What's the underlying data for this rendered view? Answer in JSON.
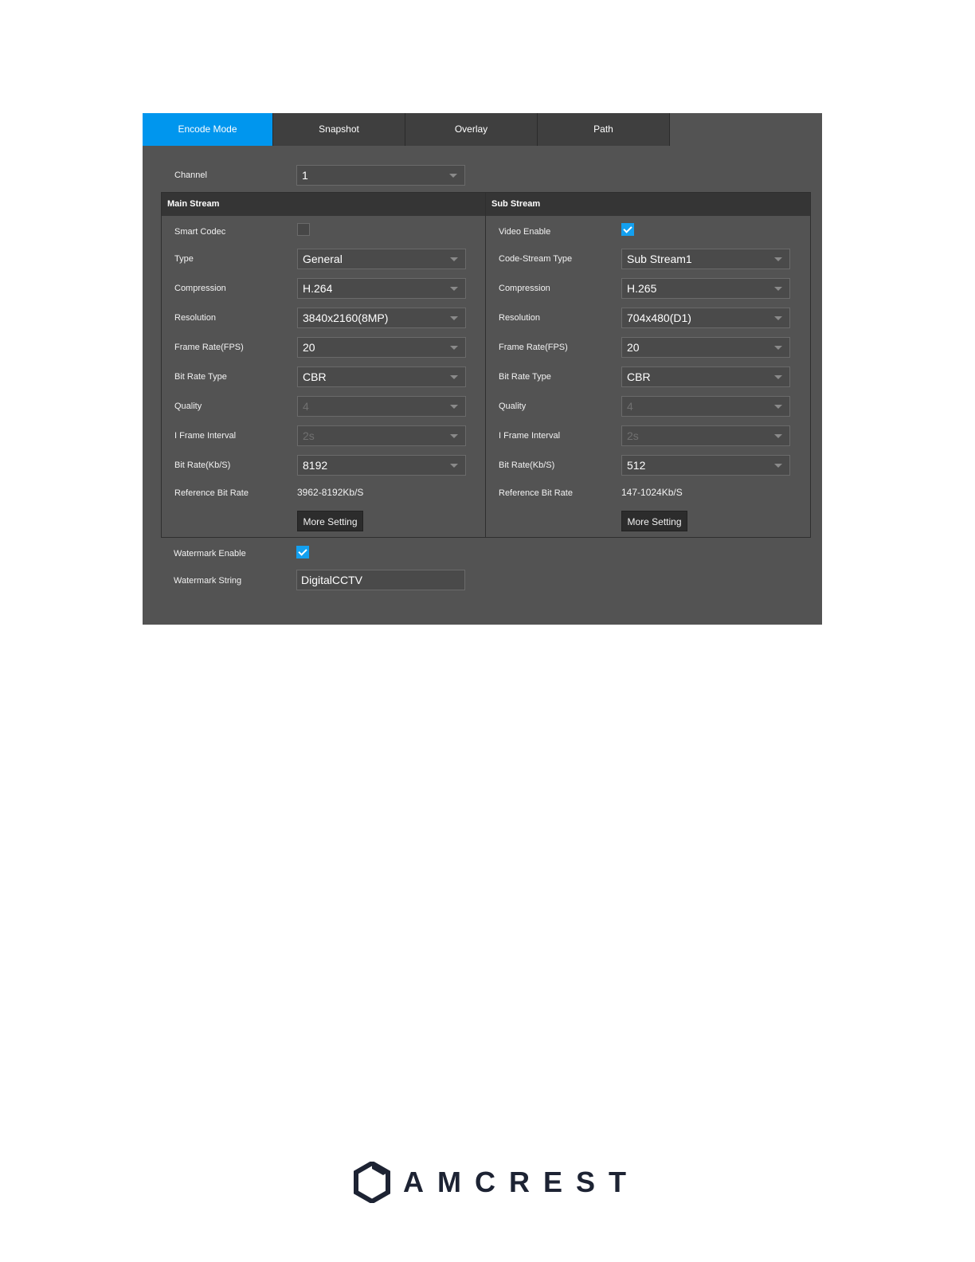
{
  "tabs": [
    {
      "label": "Encode Mode",
      "active": true
    },
    {
      "label": "Snapshot",
      "active": false
    },
    {
      "label": "Overlay",
      "active": false
    },
    {
      "label": "Path",
      "active": false
    }
  ],
  "channel": {
    "label": "Channel",
    "value": "1"
  },
  "main": {
    "title": "Main Stream",
    "smart_codec": {
      "label": "Smart Codec",
      "checked": false
    },
    "type": {
      "label": "Type",
      "value": "General"
    },
    "compression": {
      "label": "Compression",
      "value": "H.264"
    },
    "resolution": {
      "label": "Resolution",
      "value": "3840x2160(8MP)"
    },
    "frame_rate": {
      "label": "Frame Rate(FPS)",
      "value": "20"
    },
    "bit_rate_type": {
      "label": "Bit Rate Type",
      "value": "CBR"
    },
    "quality": {
      "label": "Quality",
      "value": "4"
    },
    "i_frame": {
      "label": "I Frame Interval",
      "value": "2s"
    },
    "bit_rate": {
      "label": "Bit Rate(Kb/S)",
      "value": "8192"
    },
    "ref_bit_rate": {
      "label": "Reference Bit Rate",
      "value": "3962-8192Kb/S"
    },
    "more_setting": "More Setting"
  },
  "sub": {
    "title": "Sub Stream",
    "video_enable": {
      "label": "Video Enable",
      "checked": true
    },
    "code_stream_type": {
      "label": "Code-Stream Type",
      "value": "Sub Stream1"
    },
    "compression": {
      "label": "Compression",
      "value": "H.265"
    },
    "resolution": {
      "label": "Resolution",
      "value": "704x480(D1)"
    },
    "frame_rate": {
      "label": "Frame Rate(FPS)",
      "value": "20"
    },
    "bit_rate_type": {
      "label": "Bit Rate Type",
      "value": "CBR"
    },
    "quality": {
      "label": "Quality",
      "value": "4"
    },
    "i_frame": {
      "label": "I Frame Interval",
      "value": "2s"
    },
    "bit_rate": {
      "label": "Bit Rate(Kb/S)",
      "value": "512"
    },
    "ref_bit_rate": {
      "label": "Reference Bit Rate",
      "value": "147-1024Kb/S"
    },
    "more_setting": "More Setting"
  },
  "watermark": {
    "enable": {
      "label": "Watermark Enable",
      "checked": true
    },
    "string": {
      "label": "Watermark String",
      "value": "DigitalCCTV"
    }
  },
  "colors": {
    "accent": "#0096ee",
    "panel": "#535353",
    "header": "#353535"
  },
  "logo": {
    "text": "AMCREST",
    "icon": "amcrest-hexagon-logo-icon"
  }
}
